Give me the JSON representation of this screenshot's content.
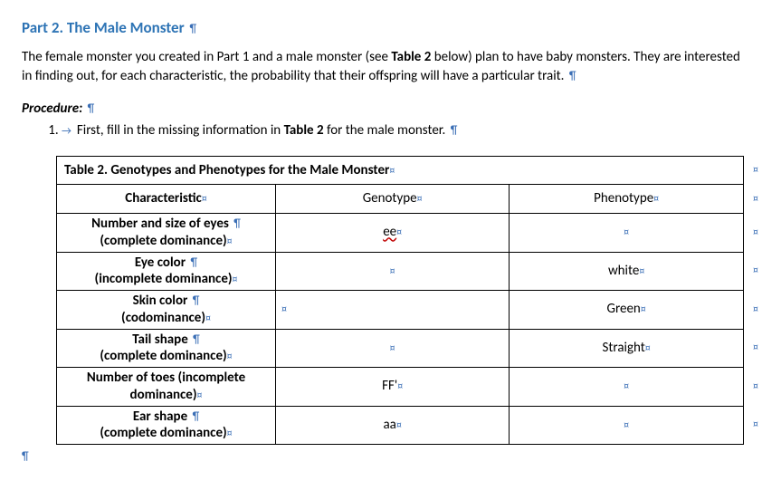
{
  "heading": "Part 2. The Male Monster",
  "intro_part1": "The female monster you created in Part 1 and a male monster (see ",
  "intro_table_ref": "Table 2",
  "intro_part2": " below) plan to have baby monsters. They are interested in finding out, for each characteristic, the probability that their offspring will have a particular trait.",
  "procedure_label": "Procedure:",
  "step1_prefix": "First, fill in the missing information in ",
  "step1_table_ref": "Table 2",
  "step1_suffix": " for the male monster.",
  "table_title": "Table 2. Genotypes and Phenotypes for the Male Monster",
  "headers": {
    "characteristic": "Characteristic",
    "genotype": "Genotype",
    "phenotype": "Phenotype"
  },
  "rows": [
    {
      "char_line1": "Number and size of eyes",
      "char_line2": "(complete dominance)",
      "genotype": "ee",
      "genotype_spellflag": true,
      "phenotype": "",
      "geno_left": false
    },
    {
      "char_line1": "Eye color",
      "char_line2": "(incomplete dominance)",
      "genotype": "",
      "genotype_spellflag": false,
      "phenotype": "white",
      "geno_left": false
    },
    {
      "char_line1": "Skin color",
      "char_line2": "(codominance)",
      "genotype": "",
      "genotype_spellflag": false,
      "phenotype": "Green",
      "geno_left": true
    },
    {
      "char_line1": "Tail shape",
      "char_line2": "(complete dominance)",
      "genotype": "",
      "genotype_spellflag": false,
      "phenotype": "Straight",
      "geno_left": false
    },
    {
      "char_line1": "Number of toes",
      "char_line2_inline": " (incomplete dominance)",
      "genotype": "FF'",
      "genotype_spellflag": false,
      "phenotype": "",
      "geno_left": false
    },
    {
      "char_line1": "Ear shape",
      "char_line2": "(complete dominance)",
      "genotype": "aa",
      "genotype_spellflag": false,
      "phenotype": "",
      "geno_left": false
    }
  ],
  "marks": {
    "pilcrow": "¶",
    "cell_end": "¤",
    "arrow": "→"
  }
}
